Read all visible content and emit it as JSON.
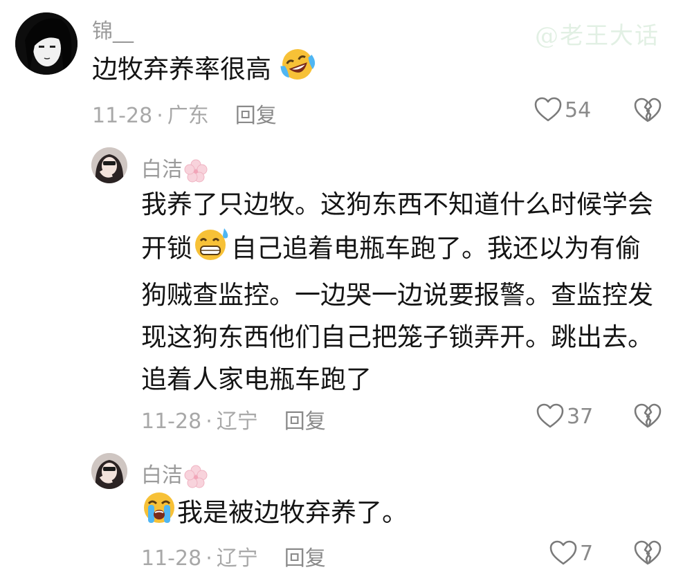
{
  "watermark": "@老王大话",
  "comments": [
    {
      "username": "锦__",
      "content_lines": [
        "边牧弃养率很高"
      ],
      "date": "11-28",
      "location": "广东",
      "reply_label": "回复",
      "likes": "54"
    },
    {
      "username": "白洁",
      "content_lines": [
        "我养了只边牧。这狗东西不知道什么时候学会",
        "开锁",
        "自己追着电瓶车跑了。我还以为有偷",
        "狗贼查监控。一边哭一边说要报警。查监控发",
        "现这狗东西他们自己把笼子锁弄开。跳出去。",
        "追着人家电瓶车跑了"
      ],
      "date": "11-28",
      "location": "辽宁",
      "reply_label": "回复",
      "likes": "37"
    },
    {
      "username": "白洁",
      "content_lines": [
        "我是被边牧弃养了。"
      ],
      "date": "11-28",
      "location": "辽宁",
      "reply_label": "回复",
      "likes": "7"
    }
  ],
  "icons": {
    "like": "heart-outline-icon",
    "dislike": "broken-heart-icon",
    "emoji_1": "laughing-crying-emoji",
    "emoji_2": "grinning-sweat-emoji",
    "emoji_3": "loudly-crying-emoji",
    "username_badge": "cherry-blossom-icon"
  },
  "colors": {
    "text": "#141414",
    "meta": "#a8a8a8",
    "emoji_yellow": "#f7c137",
    "flower": "#f6c9d3"
  }
}
